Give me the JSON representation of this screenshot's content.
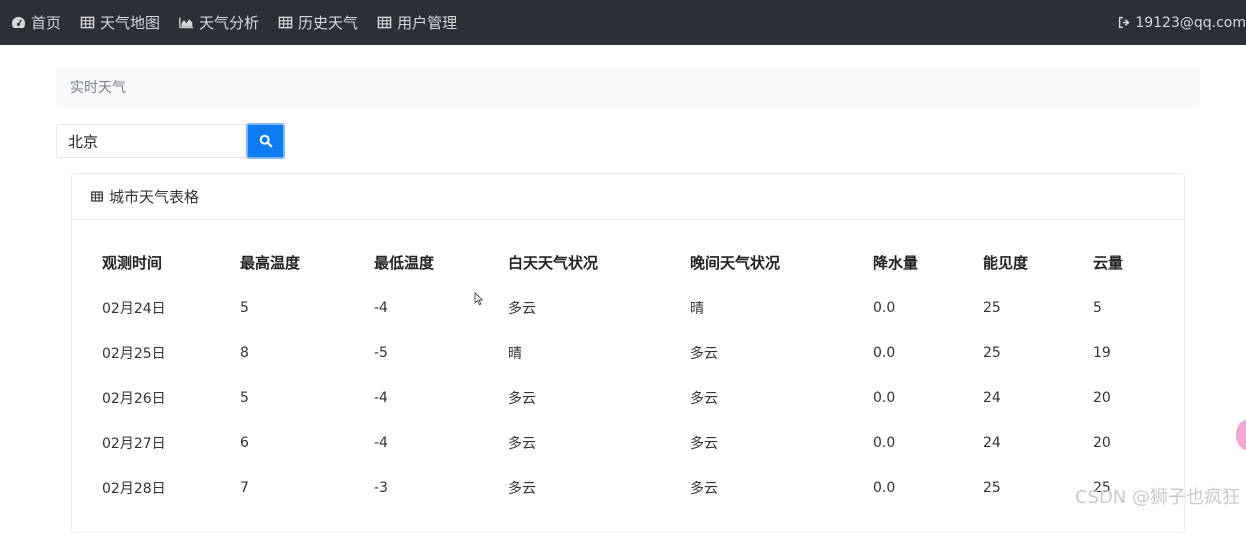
{
  "nav": {
    "items": [
      {
        "label": "首页",
        "icon": "dashboard-icon"
      },
      {
        "label": "天气地图",
        "icon": "table-icon"
      },
      {
        "label": "天气分析",
        "icon": "area-chart-icon"
      },
      {
        "label": "历史天气",
        "icon": "table-icon"
      },
      {
        "label": "用户管理",
        "icon": "table-icon"
      }
    ],
    "user": "19123@qq.com",
    "user_icon": "sign-out-icon"
  },
  "breadcrumb": "实时天气",
  "search": {
    "value": "北京",
    "button_icon": "search-icon"
  },
  "card": {
    "title": "城市天气表格",
    "title_icon": "table-icon",
    "columns": [
      "观测时间",
      "最高温度",
      "最低温度",
      "白天天气状况",
      "晚间天气状况",
      "降水量",
      "能见度",
      "云量"
    ],
    "rows": [
      [
        "02月24日",
        "5",
        "-4",
        "多云",
        "晴",
        "0.0",
        "25",
        "5"
      ],
      [
        "02月25日",
        "8",
        "-5",
        "晴",
        "多云",
        "0.0",
        "25",
        "19"
      ],
      [
        "02月26日",
        "5",
        "-4",
        "多云",
        "多云",
        "0.0",
        "24",
        "20"
      ],
      [
        "02月27日",
        "6",
        "-4",
        "多云",
        "多云",
        "0.0",
        "24",
        "20"
      ],
      [
        "02月28日",
        "7",
        "-3",
        "多云",
        "多云",
        "0.0",
        "25",
        "25"
      ]
    ]
  },
  "watermark": "CSDN @狮子也疯狂",
  "colors": {
    "navbar": "#2b2f36",
    "primary": "#0d7cf2"
  }
}
